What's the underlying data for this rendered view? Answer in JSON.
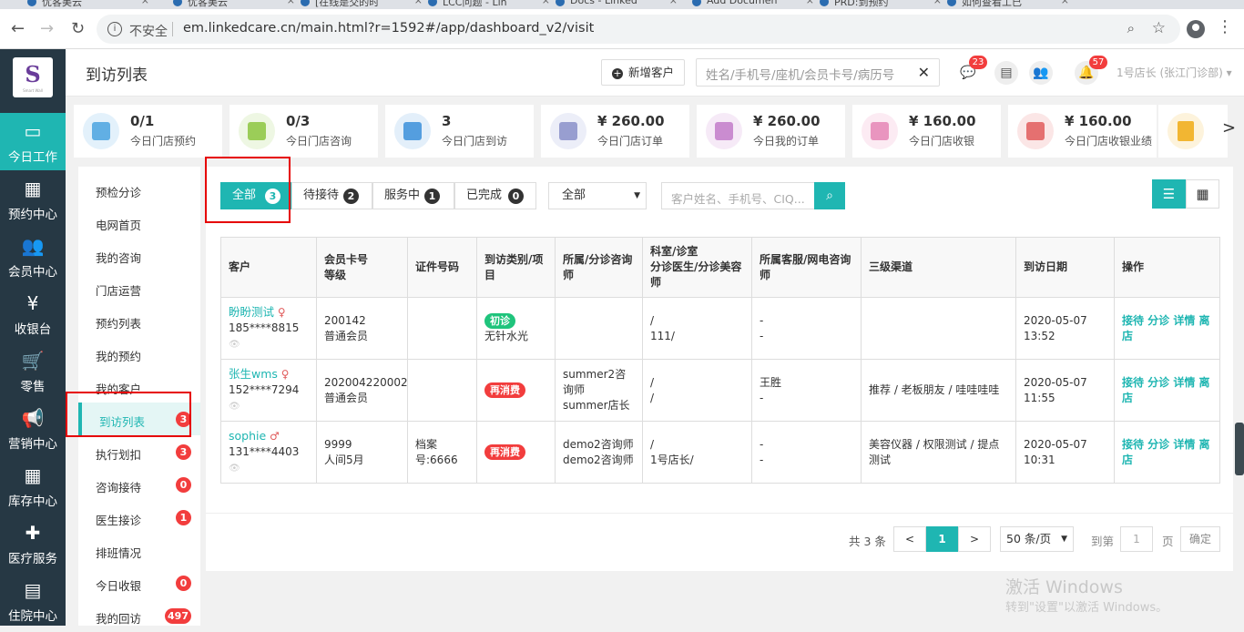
{
  "browser": {
    "tabs": [
      "优客美云",
      "优客美云",
      "[在线是交的时",
      "LCC问题 - Lin",
      "Docs - Linked",
      "Add Documen",
      "PRD:到预约",
      "如何查看工已"
    ],
    "url": "em.linkedcare.cn/main.html?r=1592#/app/dashboard_v2/visit",
    "security_label": "不安全"
  },
  "sidebar": {
    "logo_brand": "Smart Wall",
    "items": [
      {
        "label": "今日工作",
        "icon": "laptop-icon",
        "glyph": "▭"
      },
      {
        "label": "预约中心",
        "icon": "calendar-icon",
        "glyph": "▦"
      },
      {
        "label": "会员中心",
        "icon": "users-icon",
        "glyph": "👥"
      },
      {
        "label": "收银台",
        "icon": "yen-icon",
        "glyph": "¥"
      },
      {
        "label": "零售",
        "icon": "cart-icon",
        "glyph": "🛒"
      },
      {
        "label": "营销中心",
        "icon": "megaphone-icon",
        "glyph": "📢"
      },
      {
        "label": "库存中心",
        "icon": "grid-icon",
        "glyph": "▦"
      },
      {
        "label": "医疗服务",
        "icon": "medkit-icon",
        "glyph": "✚"
      },
      {
        "label": "住院中心",
        "icon": "building-icon",
        "glyph": "▤"
      }
    ]
  },
  "header": {
    "title": "到访列表",
    "add_customer": "新增客户",
    "search_placeholder": "姓名/手机号/座机/会员卡号/病历号",
    "chat_badge": "23",
    "bell_badge": "57",
    "store_user": "1号店长 (张江门诊部)"
  },
  "stats": [
    {
      "value": "0/1",
      "label": "今日门店预约",
      "color": "#4aa3df",
      "bg": "#e3f1fb"
    },
    {
      "value": "0/3",
      "label": "今日门店咨询",
      "color": "#8cc63f",
      "bg": "#eef7e3"
    },
    {
      "value": "3",
      "label": "今日门店到访",
      "color": "#3b8fd9",
      "bg": "#e3effa"
    },
    {
      "value": "¥ 260.00",
      "label": "今日门店订单",
      "color": "#8a8fc9",
      "bg": "#eceef8"
    },
    {
      "value": "¥ 260.00",
      "label": "今日我的订单",
      "color": "#c27bc9",
      "bg": "#f6eaf7"
    },
    {
      "value": "¥ 160.00",
      "label": "今日门店收银",
      "color": "#e586b5",
      "bg": "#fcebf3"
    },
    {
      "value": "¥ 160.00",
      "label": "今日门店收银业绩",
      "color": "#e05a5a",
      "bg": "#fbe6e6"
    }
  ],
  "stats_more": {
    "color": "#f2b632",
    "bg": "#fdf3dc"
  },
  "submenu": [
    {
      "label": "预检分诊",
      "badge": ""
    },
    {
      "label": "电网首页",
      "badge": ""
    },
    {
      "label": "我的咨询",
      "badge": ""
    },
    {
      "label": "门店运营",
      "badge": ""
    },
    {
      "label": "预约列表",
      "badge": ""
    },
    {
      "label": "我的预约",
      "badge": ""
    },
    {
      "label": "我的客户",
      "badge": ""
    },
    {
      "label": "到访列表",
      "badge": "3"
    },
    {
      "label": "执行划扣",
      "badge": "3"
    },
    {
      "label": "咨询接待",
      "badge": "0"
    },
    {
      "label": "医生接诊",
      "badge": "1"
    },
    {
      "label": "排班情况",
      "badge": ""
    },
    {
      "label": "今日收银",
      "badge": "0"
    },
    {
      "label": "我的回访",
      "badge": "497"
    }
  ],
  "filters": {
    "tabs": [
      {
        "label": "全部",
        "count": "3"
      },
      {
        "label": "待接待",
        "count": "2"
      },
      {
        "label": "服务中",
        "count": "1"
      },
      {
        "label": "已完成",
        "count": "0"
      }
    ],
    "type_select": "全部",
    "search_placeholder": "客户姓名、手机号、CIQ..."
  },
  "table": {
    "headers": [
      "客户",
      "会员卡号\n等级",
      "证件号码",
      "到访类别/项目",
      "所属/分诊咨询师",
      "科室/诊室\n分诊医生/分诊美容师",
      "所属客服/网电咨询师",
      "三级渠道",
      "到访日期",
      "操作"
    ],
    "rows": [
      {
        "name": "盼盼测试",
        "sex": "♀",
        "phone": "185****8815",
        "card": "200142",
        "level": "普通会员",
        "id_no": "",
        "visit_tag": "初诊",
        "visit_tag_color": "green",
        "project": "无针水光",
        "consultant": "",
        "dept": "/\n111/",
        "service": "-\n-",
        "channel": "",
        "date": "2020-05-07\n13:52",
        "ops": "接待 分诊 详情 离店"
      },
      {
        "name": "张生wms",
        "sex": "♀",
        "phone": "152****7294",
        "card": "202004220002",
        "level": "普通会员",
        "id_no": "",
        "visit_tag": "再消费",
        "visit_tag_color": "red",
        "project": "",
        "consultant": "summer2咨询师\nsummer店长",
        "dept": "/\n/",
        "service": "王胜\n-",
        "channel": "推荐 / 老板朋友 / 哇哇哇哇",
        "date": "2020-05-07\n11:55",
        "ops": "接待 分诊 详情 离店"
      },
      {
        "name": "sophie",
        "sex": "♂",
        "phone": "131****4403",
        "card": "9999",
        "level": "人间5月",
        "id_no": "档案号:6666",
        "visit_tag": "再消费",
        "visit_tag_color": "red",
        "project": "",
        "consultant": "demo2咨询师\ndemo2咨询师",
        "dept": "/\n1号店长/",
        "service": "-\n-",
        "channel": "美容仪器 / 权限测试 / 提点测试",
        "date": "2020-05-07\n10:31",
        "ops": "接待 分诊 详情 离店"
      }
    ]
  },
  "pagination": {
    "total": "共 3 条",
    "prev": "<",
    "current": "1",
    "next": ">",
    "page_size": "50 条/页",
    "goto_label": "到第",
    "goto_value": "1",
    "page_label": "页",
    "confirm": "确定"
  },
  "watermark": {
    "line1": "激活 Windows",
    "line2": "转到\"设置\"以激活 Windows。"
  }
}
